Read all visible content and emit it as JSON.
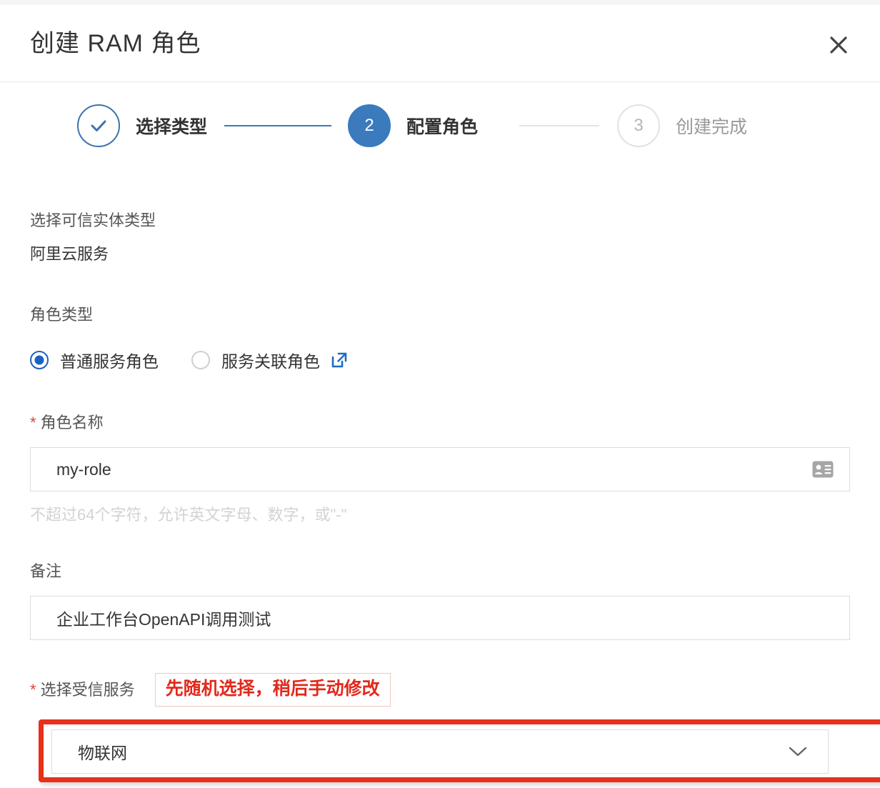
{
  "dialog": {
    "title": "创建 RAM 角色",
    "close_icon": "close-icon"
  },
  "stepper": {
    "steps": [
      {
        "index": "1",
        "label": "选择类型",
        "state": "done"
      },
      {
        "index": "2",
        "label": "配置角色",
        "state": "active"
      },
      {
        "index": "3",
        "label": "创建完成",
        "state": "todo"
      }
    ]
  },
  "form": {
    "trusted_entity": {
      "label": "选择可信实体类型",
      "value": "阿里云服务"
    },
    "role_type": {
      "label": "角色类型",
      "options": [
        {
          "label": "普通服务角色",
          "selected": true
        },
        {
          "label": "服务关联角色",
          "selected": false,
          "icon": "external-link-icon"
        }
      ]
    },
    "role_name": {
      "required_mark": "*",
      "label": "角色名称",
      "value": "my-role",
      "placeholder": "",
      "help": "不超过64个字符，允许英文字母、数字，或\"-\"",
      "field_icon": "contact-card-icon"
    },
    "notes": {
      "label": "备注",
      "value": "企业工作台OpenAPI调用测试",
      "placeholder": ""
    },
    "trusted_service": {
      "required_mark": "*",
      "label": "选择受信服务",
      "value": "物联网",
      "chevron_icon": "chevron-down-icon",
      "annotation": "先随机选择，稍后手动修改"
    }
  },
  "colors": {
    "accent_blue": "#3a7abd",
    "radio_blue": "#1b62c4",
    "annotation_red": "#e2291c",
    "highlight_red": "#e8301a",
    "required_red": "#d9453c"
  }
}
